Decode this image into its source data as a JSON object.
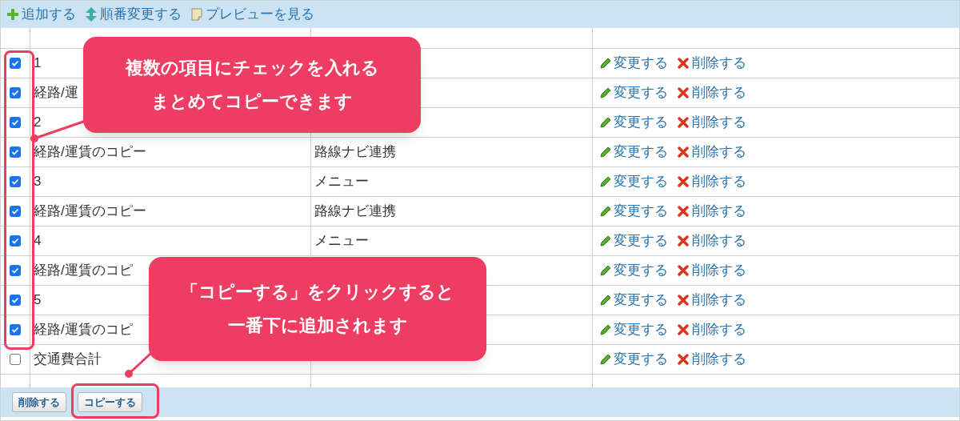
{
  "toolbar": [
    {
      "kind": "add",
      "label": "追加する"
    },
    {
      "kind": "reorder",
      "label": "順番変更する"
    },
    {
      "kind": "preview",
      "label": "プレビューを見る"
    }
  ],
  "rows": [
    {
      "checked": true,
      "name": "1",
      "edit": "変更する",
      "delete": "削除する"
    },
    {
      "checked": true,
      "name": "経路/運",
      "edit": "変更する",
      "delete": "削除する"
    },
    {
      "checked": true,
      "name": "2",
      "edit": "変更する",
      "delete": "削除する"
    },
    {
      "checked": true,
      "name": "経路/運賃のコピー",
      "type": "路線ナビ連携",
      "edit": "変更する",
      "delete": "削除する"
    },
    {
      "checked": true,
      "name": "3",
      "type": "メニュー",
      "edit": "変更する",
      "delete": "削除する"
    },
    {
      "checked": true,
      "name": "経路/運賃のコピー",
      "type": "路線ナビ連携",
      "edit": "変更する",
      "delete": "削除する"
    },
    {
      "checked": true,
      "name": "4",
      "type": "メニュー",
      "edit": "変更する",
      "delete": "削除する"
    },
    {
      "checked": true,
      "name": "経路/運賃のコピ",
      "edit": "変更する",
      "delete": "削除する"
    },
    {
      "checked": true,
      "name": "5",
      "edit": "変更する",
      "delete": "削除する"
    },
    {
      "checked": true,
      "name": "経路/運賃のコピ",
      "edit": "変更する",
      "delete": "削除する"
    },
    {
      "checked": false,
      "name": "交通費合計",
      "edit": "変更する",
      "delete": "削除する"
    }
  ],
  "footer_buttons": [
    "削除する",
    "コピーする"
  ],
  "callouts": [
    {
      "lines": [
        "複数の項目にチェックを入れる",
        "まとめてコピーできます"
      ]
    },
    {
      "lines": [
        "「コピーする」をクリックすると",
        "一番下に追加されます"
      ]
    }
  ]
}
